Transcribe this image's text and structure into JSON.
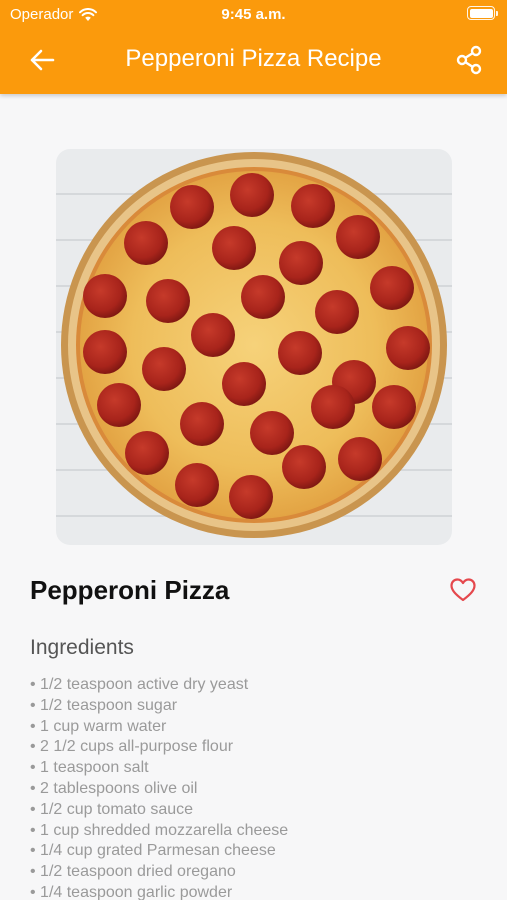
{
  "status_bar": {
    "carrier": "Operador",
    "time": "9:45 a.m."
  },
  "header": {
    "title": "Pepperoni Pizza Recipe",
    "back_icon": "arrow-left-icon",
    "share_icon": "share-icon",
    "background_color": "#fb9a0c"
  },
  "recipe": {
    "name": "Pepperoni Pizza",
    "favorite_icon": "heart-outline-icon",
    "favorite_color": "#e5484d",
    "image_alt": "pepperoni pizza photo"
  },
  "ingredients": {
    "title": "Ingredients",
    "items": [
      "• 1/2 teaspoon active dry yeast",
      "• 1/2 teaspoon sugar",
      "• 1 cup warm water",
      "• 2 1/2 cups all-purpose flour",
      "• 1 teaspoon salt",
      "• 2 tablespoons olive oil",
      "• 1/2 cup tomato sauce",
      "• 1 cup shredded mozzarella cheese",
      "• 1/4 cup grated Parmesan cheese",
      "• 1/2 teaspoon dried oregano",
      "• 1/4 teaspoon garlic powder"
    ]
  }
}
